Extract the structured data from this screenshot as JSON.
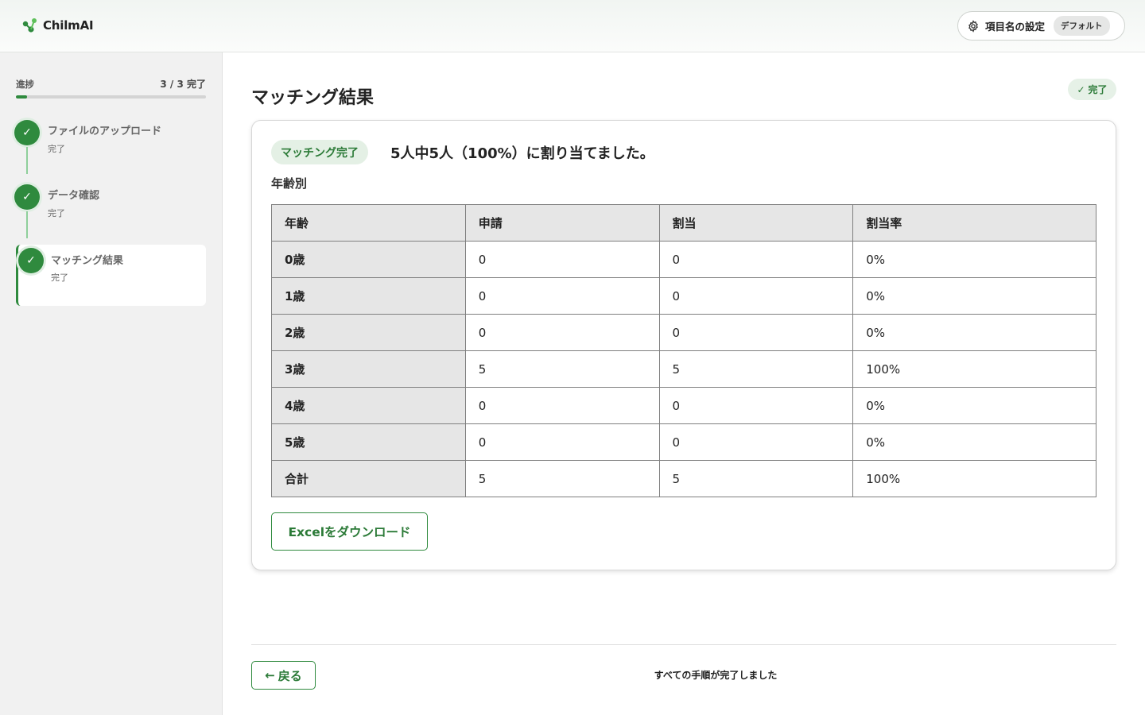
{
  "header": {
    "logo_text": "ChilmAI",
    "settings_label": "項目名の設定",
    "settings_badge": "デフォルト"
  },
  "colors": {
    "accent": "#2f8a3e",
    "accent_light": "#e4f0e5",
    "sidebar_bg": "#f1f1f1",
    "table_header_bg": "#e6e6e6"
  },
  "sidebar": {
    "progress_label": "進捗",
    "progress_count": "3 / 3 完了",
    "progress_fraction": 0.06,
    "steps": [
      {
        "check": "✓",
        "title": "ファイルのアップロード",
        "status": "完了"
      },
      {
        "check": "✓",
        "title": "データ確認",
        "status": "完了"
      },
      {
        "check": "✓",
        "title": "マッチング結果",
        "status": "完了"
      }
    ]
  },
  "main": {
    "title": "マッチング結果",
    "done_pill_check": "✓",
    "done_pill_label": "完了",
    "match_badge": "マッチング完了",
    "match_summary": "5人中5人（100%）に割り当てました。",
    "section_label": "年齢別",
    "table": {
      "headers": [
        "年齢",
        "申請",
        "割当",
        "割当率"
      ],
      "rows": [
        [
          "0歳",
          "0",
          "0",
          "0%"
        ],
        [
          "1歳",
          "0",
          "0",
          "0%"
        ],
        [
          "2歳",
          "0",
          "0",
          "0%"
        ],
        [
          "3歳",
          "5",
          "5",
          "100%"
        ],
        [
          "4歳",
          "0",
          "0",
          "0%"
        ],
        [
          "5歳",
          "0",
          "0",
          "0%"
        ],
        [
          "合計",
          "5",
          "5",
          "100%"
        ]
      ]
    },
    "excel_button": "Excelをダウンロード"
  },
  "footer": {
    "back_arrow": "←",
    "back_label": "戻る",
    "message": "すべての手順が完了しました"
  }
}
